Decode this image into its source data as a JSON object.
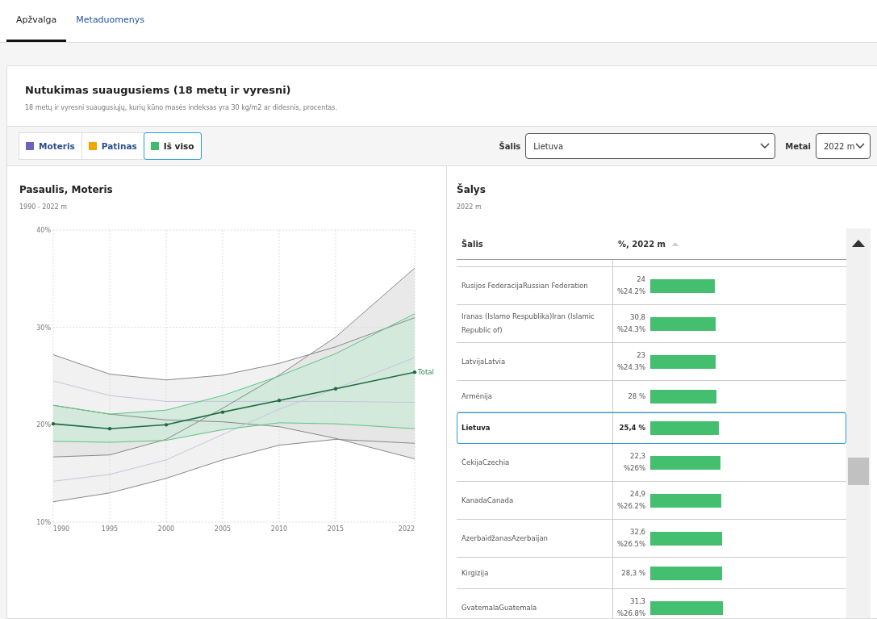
{
  "tabs": [
    {
      "label": "Apžvalga",
      "selected": true
    },
    {
      "label": "Metaduomenys",
      "selected": false
    }
  ],
  "card": {
    "title": "Nutukimas suaugusiems (18 metų ir vyresni)",
    "subtitle": "18 metų ir vyresni suaugusiųjų, kurių kūno masės indeksas yra 30 kg/m2 ar didesnis, procentas."
  },
  "legend": [
    {
      "label": "Moteris",
      "color": "#6b63c4",
      "selected": false
    },
    {
      "label": "Patinas",
      "color": "#f0a500",
      "selected": false
    },
    {
      "label": "Iš viso",
      "color": "#3dbb6a",
      "selected": true
    }
  ],
  "filters": [
    {
      "label": "Šalis",
      "value": "Lietuva"
    },
    {
      "label": "Metai",
      "value": "2022 m"
    }
  ],
  "left_panel": {
    "title": "Pasaulis, Moteris",
    "subtitle": "1990 - 2022 m",
    "chart_data": {
      "type": "line",
      "grid": true,
      "x": [
        1990,
        1995,
        2000,
        2005,
        2010,
        2015,
        2022
      ],
      "xticks": [
        1990,
        1995,
        2000,
        2005,
        2010,
        2015,
        2022
      ],
      "yticks": [
        {
          "value": 10,
          "label": "10%"
        },
        {
          "value": 20,
          "label": "20%"
        },
        {
          "value": 30,
          "label": "30%"
        },
        {
          "value": 40,
          "label": "40%"
        }
      ],
      "ylim": [
        10,
        40
      ],
      "xlim": [
        1990,
        2022
      ],
      "series": [
        {
          "color": "#888888",
          "values": [
            27.2,
            25.2,
            24.6,
            25.1,
            26.3,
            28.0,
            31.0
          ]
        },
        {
          "color": "#888888",
          "values": [
            12.1,
            13.0,
            14.5,
            16.4,
            17.9,
            18.5,
            18.1
          ]
        },
        {
          "color": "#c8c4dc",
          "values": [
            24.5,
            23.0,
            22.4,
            22.4,
            22.4,
            22.4,
            22.3
          ]
        },
        {
          "color": "#888888",
          "values": [
            22.0,
            21.1,
            20.5,
            20.3,
            19.8,
            18.6,
            16.5
          ]
        },
        {
          "color": "#888888",
          "values": [
            16.7,
            16.9,
            18.5,
            21.7,
            25.1,
            29.0,
            36.1
          ]
        },
        {
          "color": "#c8c4dc",
          "values": [
            14.2,
            14.9,
            16.4,
            19.0,
            21.6,
            23.7,
            26.9
          ]
        },
        {
          "color": "#5cc486",
          "values": [
            22.0,
            21.1,
            21.5,
            23.0,
            25.0,
            27.3,
            31.4
          ]
        },
        {
          "color": "#5cc486",
          "values": [
            18.3,
            18.2,
            18.4,
            19.5,
            20.2,
            20.1,
            19.6
          ]
        },
        {
          "name": "Total",
          "color": "#1f6b3f",
          "values": [
            20.1,
            19.6,
            20.0,
            21.3,
            22.5,
            23.7,
            25.4
          ]
        }
      ]
    }
  },
  "right_panel": {
    "title": "Šalys",
    "subtitle": "2022 m",
    "table": {
      "columns": [
        "Šalis",
        "%, 2022 m"
      ],
      "rows": [
        {
          "country": "Rusijos FederacijaRussian Federation",
          "value": "24",
          "note": "%24.2%",
          "level": 0.33,
          "selected": false
        },
        {
          "country": "Iranas (Islamo Respublika)Iran (Islamic Republic of)",
          "value": "30,8",
          "note": "%24.3%",
          "level": 0.332,
          "selected": false
        },
        {
          "country": "LatvijaLatvia",
          "value": "23",
          "note": "%24.3%",
          "level": 0.333,
          "selected": false
        },
        {
          "country": "Armėnija",
          "value": "28 %",
          "level": 0.336,
          "selected": false
        },
        {
          "country": "Lietuva",
          "value": "25,4 %",
          "level": 0.35,
          "selected": true
        },
        {
          "country": "ČekijaCzechia",
          "value": "22,3",
          "note": "%26%",
          "level": 0.36,
          "selected": false
        },
        {
          "country": "KanadaCanada",
          "value": "24,9",
          "note": "%26.2%",
          "level": 0.362,
          "selected": false
        },
        {
          "country": "AzerbaidžanasAzerbaijan",
          "value": "32,6",
          "note": "%26.5%",
          "level": 0.366,
          "selected": false
        },
        {
          "country": "Kirgizija",
          "value": "28,3 %",
          "level": 0.366,
          "selected": false
        },
        {
          "country": "GvatemalaGuatemala",
          "value": "31,3",
          "note": "%26.8%",
          "level": 0.37,
          "selected": false
        }
      ]
    }
  }
}
